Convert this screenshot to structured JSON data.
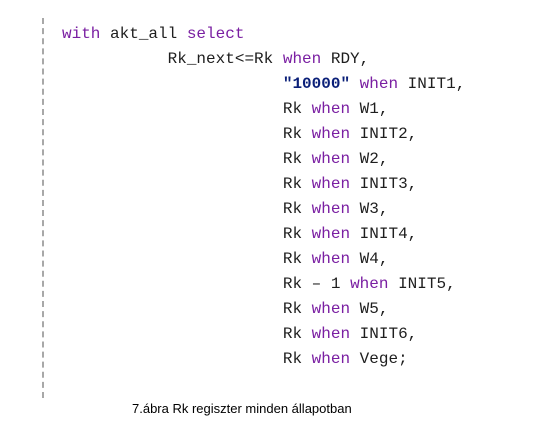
{
  "colors": {
    "keyword": "#7a1fa2",
    "string": "#0a1f78",
    "text": "#1e1e1e",
    "gutter": "#a8a8a8"
  },
  "code": {
    "lines": [
      {
        "indent": 0,
        "tokens": [
          {
            "t": "with",
            "c": "kw"
          },
          {
            "t": " akt_all ",
            "c": "plain"
          },
          {
            "t": "select",
            "c": "kw"
          }
        ]
      },
      {
        "indent": 11,
        "tokens": [
          {
            "t": "Rk_next<=Rk ",
            "c": "plain"
          },
          {
            "t": "when",
            "c": "kw"
          },
          {
            "t": " RDY,",
            "c": "plain"
          }
        ]
      },
      {
        "indent": 23,
        "tokens": [
          {
            "t": "\"10000\"",
            "c": "str"
          },
          {
            "t": " ",
            "c": "plain"
          },
          {
            "t": "when",
            "c": "kw"
          },
          {
            "t": " INIT1,",
            "c": "plain"
          }
        ]
      },
      {
        "indent": 23,
        "tokens": [
          {
            "t": "Rk ",
            "c": "plain"
          },
          {
            "t": "when",
            "c": "kw"
          },
          {
            "t": " W1,",
            "c": "plain"
          }
        ]
      },
      {
        "indent": 23,
        "tokens": [
          {
            "t": "Rk ",
            "c": "plain"
          },
          {
            "t": "when",
            "c": "kw"
          },
          {
            "t": " INIT2,",
            "c": "plain"
          }
        ]
      },
      {
        "indent": 23,
        "tokens": [
          {
            "t": "Rk ",
            "c": "plain"
          },
          {
            "t": "when",
            "c": "kw"
          },
          {
            "t": " W2,",
            "c": "plain"
          }
        ]
      },
      {
        "indent": 23,
        "tokens": [
          {
            "t": "Rk ",
            "c": "plain"
          },
          {
            "t": "when",
            "c": "kw"
          },
          {
            "t": " INIT3,",
            "c": "plain"
          }
        ]
      },
      {
        "indent": 23,
        "tokens": [
          {
            "t": "Rk ",
            "c": "plain"
          },
          {
            "t": "when",
            "c": "kw"
          },
          {
            "t": " W3,",
            "c": "plain"
          }
        ]
      },
      {
        "indent": 23,
        "tokens": [
          {
            "t": "Rk ",
            "c": "plain"
          },
          {
            "t": "when",
            "c": "kw"
          },
          {
            "t": " INIT4,",
            "c": "plain"
          }
        ]
      },
      {
        "indent": 23,
        "tokens": [
          {
            "t": "Rk ",
            "c": "plain"
          },
          {
            "t": "when",
            "c": "kw"
          },
          {
            "t": " W4,",
            "c": "plain"
          }
        ]
      },
      {
        "indent": 23,
        "tokens": [
          {
            "t": "Rk – 1 ",
            "c": "plain"
          },
          {
            "t": "when",
            "c": "kw"
          },
          {
            "t": " INIT5,",
            "c": "plain"
          }
        ]
      },
      {
        "indent": 23,
        "tokens": [
          {
            "t": "Rk ",
            "c": "plain"
          },
          {
            "t": "when",
            "c": "kw"
          },
          {
            "t": " W5,",
            "c": "plain"
          }
        ]
      },
      {
        "indent": 23,
        "tokens": [
          {
            "t": "Rk ",
            "c": "plain"
          },
          {
            "t": "when",
            "c": "kw"
          },
          {
            "t": " INIT6,",
            "c": "plain"
          }
        ]
      },
      {
        "indent": 23,
        "tokens": [
          {
            "t": "Rk ",
            "c": "plain"
          },
          {
            "t": "when",
            "c": "kw"
          },
          {
            "t": " Vege;",
            "c": "plain"
          }
        ]
      }
    ]
  },
  "caption": "7.ábra Rk regiszter minden állapotban"
}
